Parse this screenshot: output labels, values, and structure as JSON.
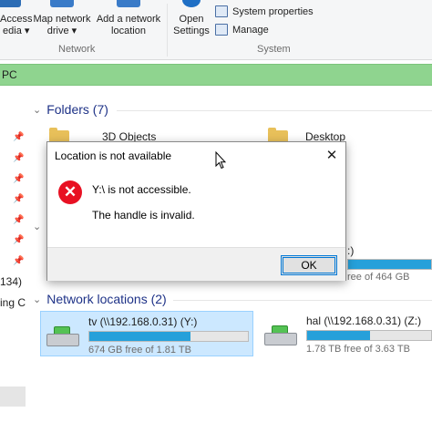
{
  "ribbon": {
    "media": {
      "line1": "Access",
      "line2": "edia ▾"
    },
    "map_drive": {
      "line1": "Map network",
      "line2": "drive ▾"
    },
    "add_location": {
      "line1": "Add a network",
      "line2": "location"
    },
    "open_settings": {
      "line1": "Open",
      "line2": "Settings"
    },
    "system_properties": "System properties",
    "manage": "Manage",
    "group_network": "Network",
    "group_system": "System"
  },
  "address": {
    "text": "PC"
  },
  "nav": {
    "partial_count": "134)",
    "partial_label": "ing C"
  },
  "folders": {
    "heading": "Folders (7)",
    "items": [
      "3D Objects",
      "Desktop"
    ]
  },
  "devices": {
    "partial_free": "ree of 464 GB"
  },
  "network": {
    "heading": "Network locations (2)",
    "drives": [
      {
        "name": "tv (\\\\192.168.0.31) (Y:)",
        "free": "674 GB free of 1.81 TB",
        "used_fraction": 0.64
      },
      {
        "name": "hal (\\\\192.168.0.31) (Z:)",
        "free": "1.78 TB free of 3.63 TB",
        "used_fraction": 0.51
      }
    ]
  },
  "dialog": {
    "title": "Location is not available",
    "message": "Y:\\ is not accessible.",
    "detail": "The handle is invalid.",
    "ok_label": "OK"
  },
  "colors": {
    "address_bar": "#8fd48f",
    "accent": "#0078d7",
    "error": "#e81123",
    "usage_bar": "#26a0da",
    "selection": "#cce8ff"
  }
}
